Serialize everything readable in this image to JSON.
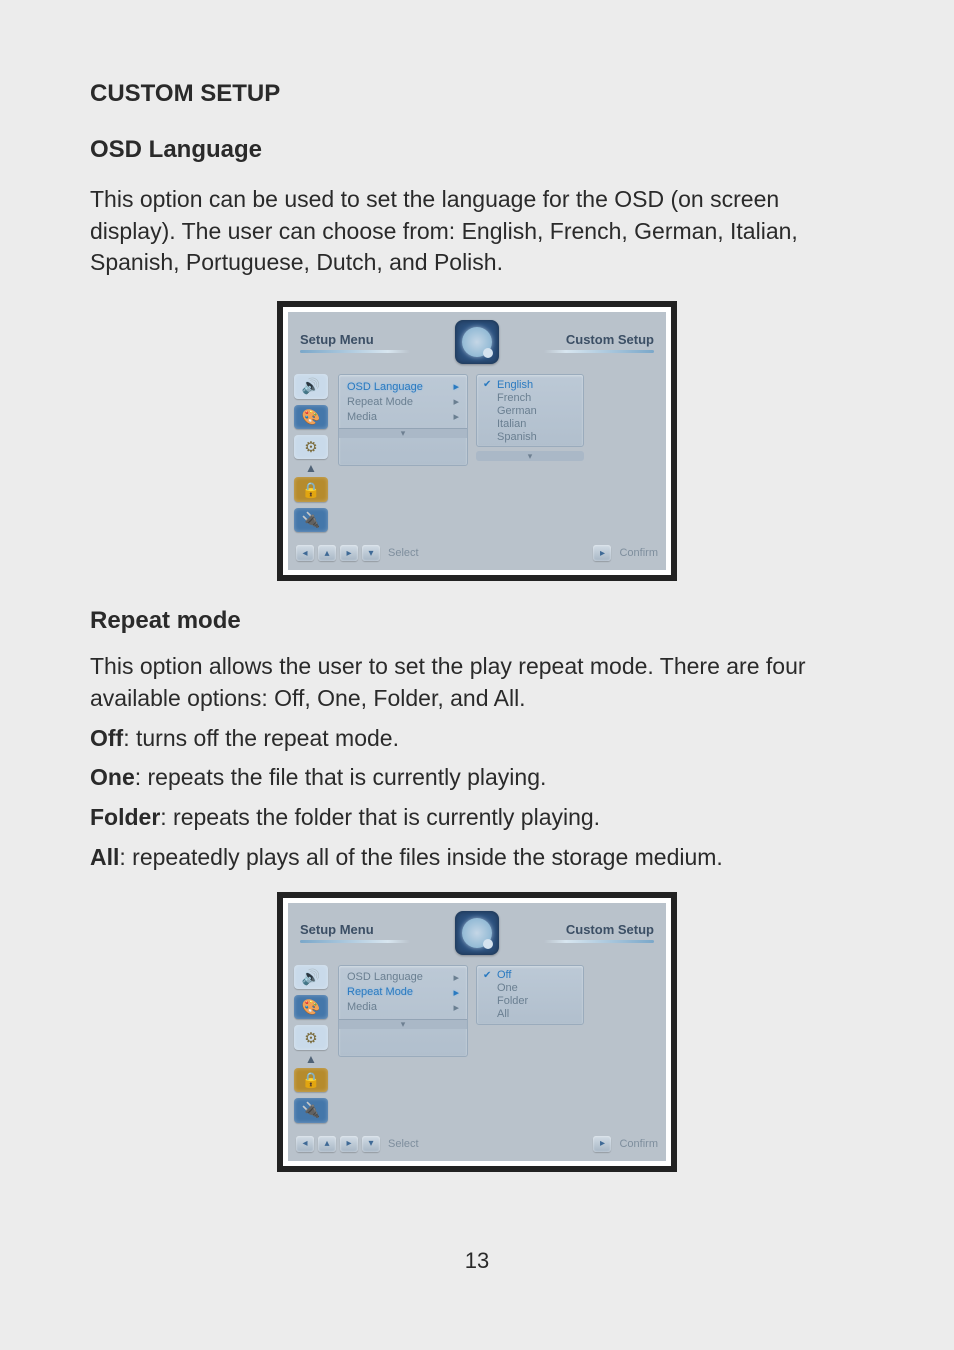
{
  "page": {
    "header": "CUSTOM SETUP",
    "osd_heading": "OSD Language",
    "osd_para": "This option can be used to set the language for the OSD (on screen display). The user can choose from: English, French, German, Italian, Spanish, Portuguese, Dutch, and Polish.",
    "repeat_heading": "Repeat mode",
    "repeat_para": "This option allows the user to set the play repeat mode.  There are four available options: Off, One, Folder, and All.",
    "off_b": "Off",
    "off_t": ": turns off the repeat mode.",
    "one_b": "One",
    "one_t": ": repeats the file that is currently playing.",
    "folder_b": "Folder",
    "folder_t": ": repeats the folder that is currently playing.",
    "all_b": "All",
    "all_t": ": repeatedly plays all of the files inside the storage medium.",
    "page_number": "13"
  },
  "fig1": {
    "title_left": "Setup Menu",
    "title_right": "Custom Setup",
    "menu": {
      "osd": "OSD Language",
      "repeat": "Repeat Mode",
      "media": "Media"
    },
    "opts": {
      "english": "English",
      "french": "French",
      "german": "German",
      "italian": "Italian",
      "spanish": "Spanish"
    },
    "footer": {
      "select": "Select",
      "confirm": "Confirm"
    }
  },
  "fig2": {
    "title_left": "Setup Menu",
    "title_right": "Custom Setup",
    "menu": {
      "osd": "OSD Language",
      "repeat": "Repeat Mode",
      "media": "Media"
    },
    "opts": {
      "off": "Off",
      "one": "One",
      "folder": "Folder",
      "all": "All"
    },
    "footer": {
      "select": "Select",
      "confirm": "Confirm"
    }
  }
}
